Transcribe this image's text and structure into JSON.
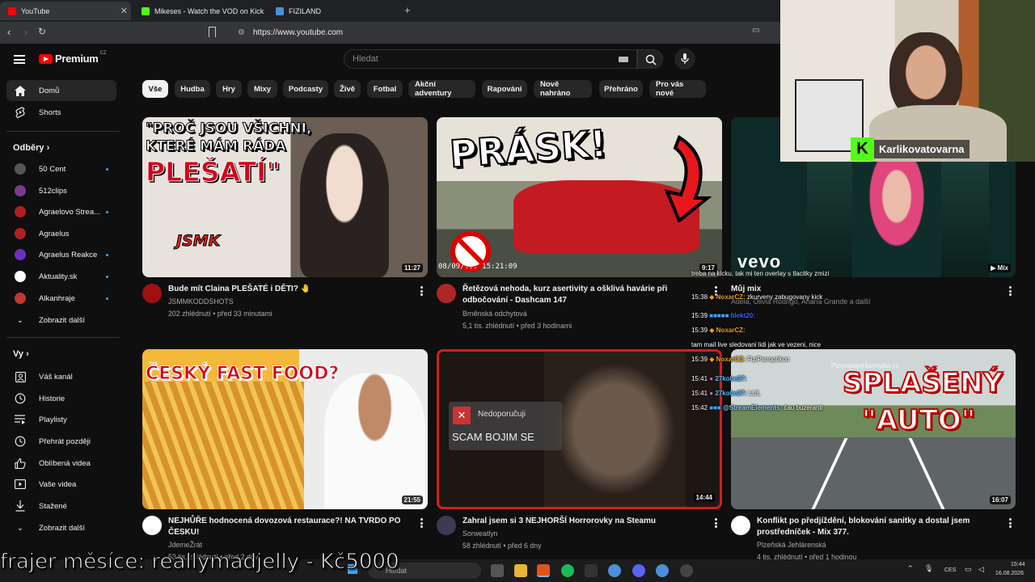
{
  "browser": {
    "tabs": [
      {
        "label": "YouTube",
        "color": "#ff0000"
      },
      {
        "label": "Mikeses - Watch the VOD on Kick",
        "color": "#53fc18"
      },
      {
        "label": "FIZILAND",
        "color": "#4a90d9"
      }
    ],
    "url": "https://www.youtube.com"
  },
  "masthead": {
    "brand": "Premium",
    "country": "CZ",
    "search_placeholder": "Hledat"
  },
  "sidebar": {
    "home": "Domů",
    "shorts": "Shorts",
    "subs_heading": "Odběry",
    "subs": [
      {
        "label": "50 Cent",
        "color": "#555"
      },
      {
        "label": "512clips",
        "color": "#7a3b8c"
      },
      {
        "label": "Agraelovo Strea...",
        "color": "#b02020"
      },
      {
        "label": "Agraelus",
        "color": "#b02020"
      },
      {
        "label": "Agraelus Reakce",
        "color": "#6d2fc4"
      },
      {
        "label": "Aktuality.sk",
        "color": "#ffffff"
      },
      {
        "label": "Alkanhraje",
        "color": "#c0392b"
      }
    ],
    "show_more_subs": "Zobrazit další",
    "you_heading": "Vy",
    "you_items": [
      "Váš kanál",
      "Historie",
      "Playlisty",
      "Přehrát později",
      "Oblíbená videa",
      "Vaše videa",
      "Stažené",
      "Zobrazit další"
    ]
  },
  "chips": [
    "Vše",
    "Hudba",
    "Hry",
    "Mixy",
    "Podcasty",
    "Živě",
    "Fotbal",
    "Akční adventury",
    "Rapování",
    "Nově nahráno",
    "Přehráno",
    "Pro vás nové"
  ],
  "videos": [
    {
      "title": "Bude mít Claina PLEŠATÉ i DĚTI? 🤚",
      "channel": "JSMMKODDSHOTS",
      "meta": "202 zhlédnutí • před 33 minutami",
      "duration": "11:27",
      "thumb_text1": "\"PROČ JSOU VŠICHNI,",
      "thumb_text2": "KTERÉ MÁM RÁDA",
      "thumb_text3": "PLEŠATÍ\"",
      "thumb_logo": "JSMK"
    },
    {
      "title": "Řetězová nehoda, kurz asertivity a ošklivá havárie při odbočování - Dashcam 147",
      "channel": "Brněnská odchytová",
      "meta": "5,1 tis. zhlédnutí • před 3 hodinami",
      "duration": "9:17",
      "thumb_text1": "PRÁSK!",
      "thumb_ts": "08/09/... 15:21:09"
    },
    {
      "title": "Můj mix",
      "channel": "Adela, Olivia Rodrigo, Ariana Grande a další",
      "badge": "Mix",
      "vevo": "vevo"
    },
    {
      "title": "NEJHŮŘE hodnocená dovozová restaurace?! NA TVRDO PO ČESKU!",
      "channel": "JdemeŽrát",
      "meta": "53 tis. zhlédnutí • před 2 dny",
      "duration": "21:55",
      "thumb_text1": "ČESKÝ FAST FOOD?"
    },
    {
      "title": "Zahral jsem si 3 NEJHORŠÍ Horrorovky na Steamu",
      "channel": "Sorweatlyn",
      "meta": "58 zhlédnutí • před 6 dny",
      "duration": "14:44",
      "thumb_text1": "Nedoporučuji",
      "thumb_text2": "SCAM BOJIM SE"
    },
    {
      "title": "Konflikt po předjíždění, blokování sanitky a dostal jsem prostředníček - Mix 377.",
      "channel": "Plzeňská Jehlárenská",
      "meta": "4 tis. zhlédnutí • před 1 hodinou",
      "duration": "16:07",
      "thumb_text1": "SPLAŠENÝ",
      "thumb_text2": "\"AUTO\"",
      "thumb_url": "Plzenskajehlarenska.cz"
    }
  ],
  "stream": {
    "streamer": "Karlikovatovarna",
    "chat": [
      {
        "time": "",
        "name": "",
        "text": "treba na kicku, tak mi ten overlay s tlacitky zmizi"
      },
      {
        "time": "15:38",
        "name": "NoxarCZ:",
        "text": "zkurveny zabugovany kick"
      },
      {
        "time": "15:39",
        "name": "blekt20:",
        "text": ""
      },
      {
        "time": "15:39",
        "name": "NoxarCZ:",
        "text": "tam mail live sledovani lidi jak ve vezeni, nice"
      },
      {
        "time": "15:39",
        "name": "NoxarCZ:",
        "text": "FiziPanoptikon"
      },
      {
        "time": "15:41",
        "name": "27kobe27:",
        "text": ""
      },
      {
        "time": "15:41",
        "name": "27kobe27:",
        "text": "LUL"
      },
      {
        "time": "15:42",
        "name": "@StreamElements:",
        "text": "čau buzeranti"
      }
    ],
    "donation": "frajer měsíce: reallymadjelly - Kč5000"
  },
  "taskbar": {
    "search": "Hledat",
    "lang": "CES",
    "time": "15:44",
    "date": "16.08.2026"
  }
}
